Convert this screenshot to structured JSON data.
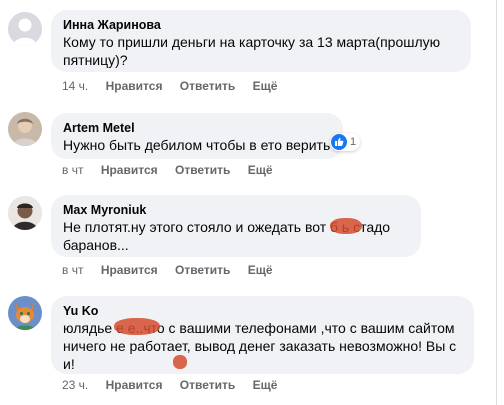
{
  "comments": [
    {
      "author": "Инна Жаринова",
      "text": "Кому то пришли деньги на карточку за 13 марта(прошлую пятницу)?",
      "time": "14 ч.",
      "like": "Нравится",
      "reply": "Ответить",
      "more": "Ещё"
    },
    {
      "author": "Artem Metel",
      "text": "Нужно быть дебилом чтобы в ето верить",
      "time": "в чт",
      "like": "Нравится",
      "reply": "Ответить",
      "more": "Ещё",
      "reaction_count": "1"
    },
    {
      "author": "Max Myroniuk",
      "text": "Не плотят.ну этого стояло и ожедать вот б     ь стадо баранов...",
      "time": "в чт",
      "like": "Нравится",
      "reply": "Ответить",
      "more": "Ещё"
    },
    {
      "author": "Yu Ko",
      "text": "юлядье е          е..что с вашими телефонами ,что с вашим сайтом ничего не работает, вывод денег заказать невозможно! Вы с   и!",
      "time": "23 ч.",
      "like": "Нравится",
      "reply": "Ответить",
      "more": "Ещё"
    }
  ],
  "colors": {
    "bubble": "#f0f2f5",
    "meta": "#65676b",
    "like_blue": "#1877f2",
    "censor": "#d44c2e"
  }
}
